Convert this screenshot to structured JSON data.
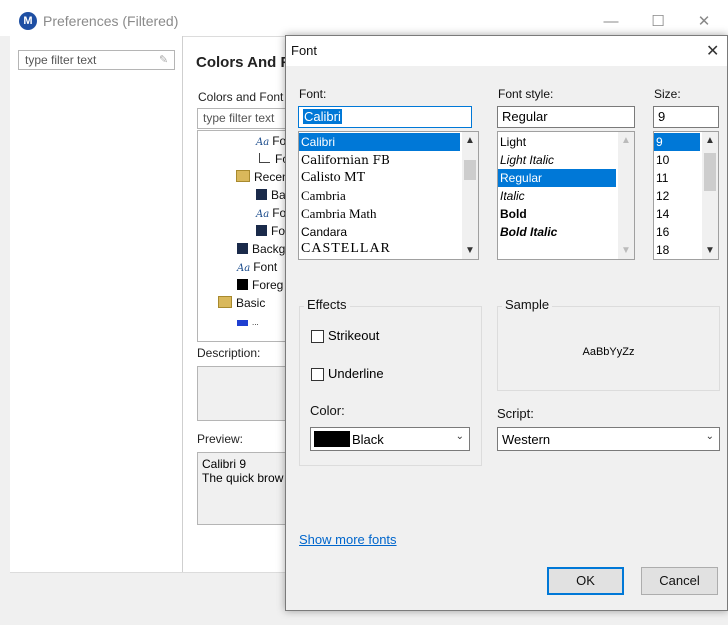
{
  "preferences": {
    "title": "Preferences (Filtered)",
    "logo_letter": "M",
    "filter_placeholder": "type filter text",
    "page_title": "Colors And F",
    "cf_label": "Colors and Font",
    "cf_filter_placeholder": "type filter text",
    "tree": [
      {
        "icon": "aa",
        "label": "Fo"
      },
      {
        "icon": "line",
        "label": "Fo"
      },
      {
        "icon": "folder",
        "label": "Recen"
      },
      {
        "icon": "swatch-navy",
        "label": "Ba"
      },
      {
        "icon": "aa",
        "label": "Fo"
      },
      {
        "icon": "swatch-navy",
        "label": "Fo"
      },
      {
        "icon": "swatch-navy",
        "label": "Backg"
      },
      {
        "icon": "aa",
        "label": "Font"
      },
      {
        "icon": "swatch-black",
        "label": "Foreg"
      },
      {
        "icon": "folder",
        "label": "Basic"
      },
      {
        "icon": "swatch-blue",
        "label": "..."
      }
    ],
    "description_label": "Description:",
    "preview_label": "Preview:",
    "preview_lines": [
      "Calibri 9",
      "The quick brow"
    ]
  },
  "font_dialog": {
    "title": "Font",
    "font_label": "Font:",
    "font_value": "Calibri",
    "fonts": [
      "Calibri",
      "Californian FB",
      "Calisto MT",
      "Cambria",
      "Cambria Math",
      "Candara",
      "CASTELLAR"
    ],
    "selected_font_index": 0,
    "style_label": "Font style:",
    "style_value": "Regular",
    "styles": [
      "Light",
      "Light Italic",
      "Regular",
      "Italic",
      "Bold",
      "Bold Italic"
    ],
    "selected_style_index": 2,
    "size_label": "Size:",
    "size_value": "9",
    "sizes": [
      "9",
      "10",
      "11",
      "12",
      "14",
      "16",
      "18"
    ],
    "selected_size_index": 0,
    "effects_label": "Effects",
    "strikeout_label": "Strikeout",
    "strikeout_checked": false,
    "underline_label": "Underline",
    "underline_checked": false,
    "color_label": "Color:",
    "color_value": "Black",
    "color_swatch": "#000000",
    "sample_label": "Sample",
    "sample_text": "AaBbYyZz",
    "script_label": "Script:",
    "script_value": "Western",
    "show_more_fonts": "Show more fonts",
    "ok_label": "OK",
    "cancel_label": "Cancel",
    "close_glyph": "✕"
  },
  "colors": {
    "accent": "#0078d7",
    "link": "#0066cc",
    "navy_swatch": "#1a2a4a",
    "blue_swatch": "#1f3fd1"
  }
}
